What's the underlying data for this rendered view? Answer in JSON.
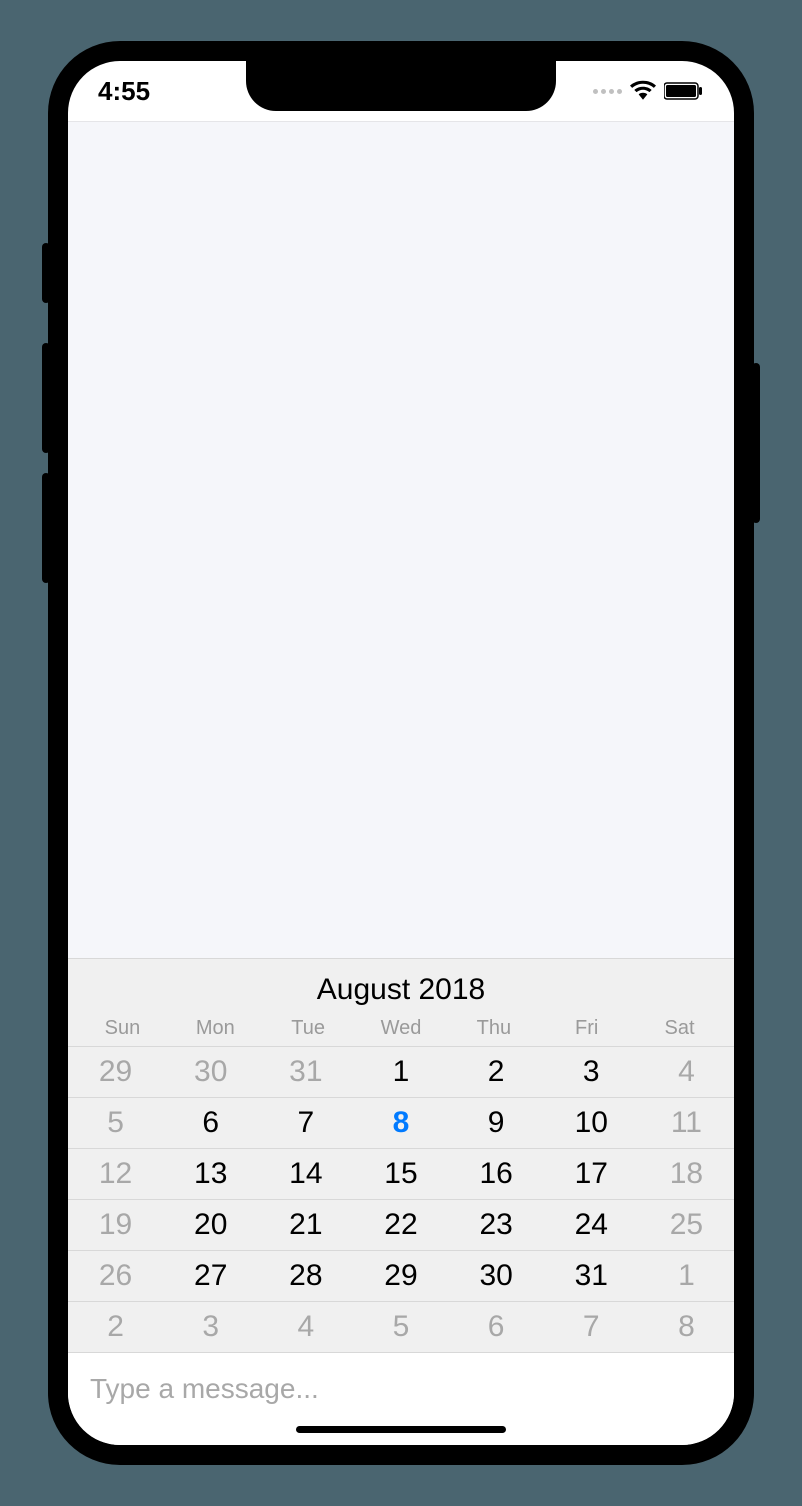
{
  "status": {
    "time": "4:55"
  },
  "calendar": {
    "title": "August 2018",
    "weekdays": [
      "Sun",
      "Mon",
      "Tue",
      "Wed",
      "Thu",
      "Fri",
      "Sat"
    ],
    "days": [
      {
        "d": "29",
        "muted": true
      },
      {
        "d": "30",
        "muted": true
      },
      {
        "d": "31",
        "muted": true
      },
      {
        "d": "1"
      },
      {
        "d": "2"
      },
      {
        "d": "3"
      },
      {
        "d": "4",
        "muted": true
      },
      {
        "d": "5",
        "muted": true
      },
      {
        "d": "6"
      },
      {
        "d": "7"
      },
      {
        "d": "8",
        "today": true
      },
      {
        "d": "9"
      },
      {
        "d": "10"
      },
      {
        "d": "11",
        "muted": true
      },
      {
        "d": "12",
        "muted": true
      },
      {
        "d": "13"
      },
      {
        "d": "14"
      },
      {
        "d": "15"
      },
      {
        "d": "16"
      },
      {
        "d": "17"
      },
      {
        "d": "18",
        "muted": true
      },
      {
        "d": "19",
        "muted": true
      },
      {
        "d": "20"
      },
      {
        "d": "21"
      },
      {
        "d": "22"
      },
      {
        "d": "23"
      },
      {
        "d": "24"
      },
      {
        "d": "25",
        "muted": true
      },
      {
        "d": "26",
        "muted": true
      },
      {
        "d": "27"
      },
      {
        "d": "28"
      },
      {
        "d": "29"
      },
      {
        "d": "30"
      },
      {
        "d": "31"
      },
      {
        "d": "1",
        "muted": true
      },
      {
        "d": "2",
        "muted": true
      },
      {
        "d": "3",
        "muted": true
      },
      {
        "d": "4",
        "muted": true
      },
      {
        "d": "5",
        "muted": true
      },
      {
        "d": "6",
        "muted": true
      },
      {
        "d": "7",
        "muted": true
      },
      {
        "d": "8",
        "muted": true
      }
    ]
  },
  "input": {
    "placeholder": "Type a message..."
  }
}
